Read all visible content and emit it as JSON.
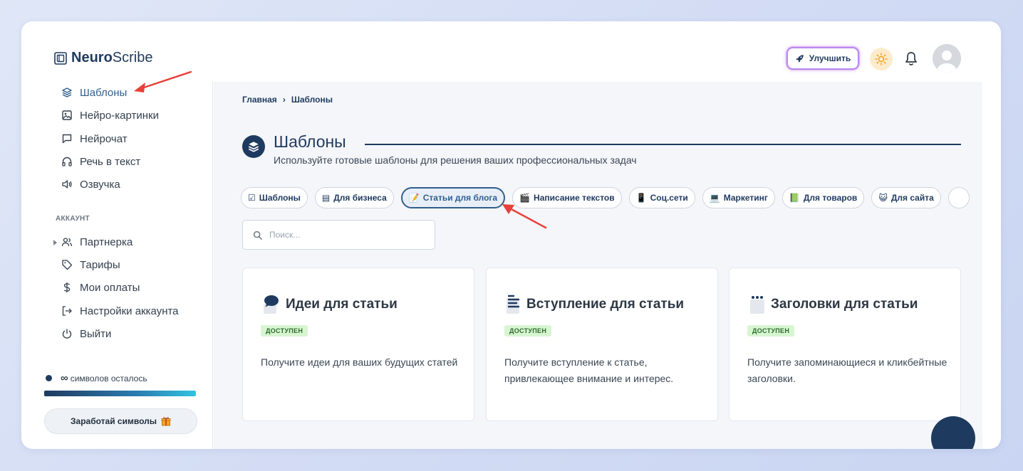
{
  "app": {
    "logo_bold": "Neuro",
    "logo_regular": "Scribe"
  },
  "header": {
    "upgrade_label": "Улучшить"
  },
  "sidebar": {
    "items": [
      {
        "label": "Шаблоны",
        "icon": "layers-icon",
        "active": true
      },
      {
        "label": "Нейро-картинки",
        "icon": "image-icon"
      },
      {
        "label": "Нейрочат",
        "icon": "chat-icon"
      },
      {
        "label": "Речь в текст",
        "icon": "headphones-icon"
      },
      {
        "label": "Озвучка",
        "icon": "speaker-icon"
      }
    ],
    "account_label": "АККАУНТ",
    "account_items": [
      {
        "label": "Партнерка",
        "icon": "users-icon"
      },
      {
        "label": "Тарифы",
        "icon": "tag-icon"
      },
      {
        "label": "Мои оплаты",
        "icon": "dollar-icon"
      },
      {
        "label": "Настройки аккаунта",
        "icon": "login-icon"
      },
      {
        "label": "Выйти",
        "icon": "power-icon"
      }
    ],
    "symbols_value": "∞",
    "symbols_label": "символов осталось",
    "symbols_progress": 1.0,
    "earn_label": "Заработай символы"
  },
  "main": {
    "breadcrumb": {
      "home": "Главная",
      "separator": "›",
      "current": "Шаблоны"
    },
    "title": "Шаблоны",
    "subtitle": "Используйте готовые шаблоны для решения ваших профессиональных задач",
    "chips": [
      {
        "emoji": "☑",
        "label": "Шаблоны"
      },
      {
        "emoji": "▤",
        "label": "Для бизнеса"
      },
      {
        "emoji": "📝",
        "label": "Статьи для блога",
        "active": true
      },
      {
        "emoji": "🎬",
        "label": "Написание текстов"
      },
      {
        "emoji": "📱",
        "label": "Соц.сети"
      },
      {
        "emoji": "💻",
        "label": "Маркетинг"
      },
      {
        "emoji": "📗",
        "label": "Для товаров"
      },
      {
        "emoji": "😺",
        "label": "Для сайта"
      }
    ],
    "search_placeholder": "Поиск...",
    "cards": [
      {
        "title": "Идеи для статьи",
        "icon": "speech-bubble-icon",
        "badge": "ДОСТУПЕН",
        "description": "Получите идеи для ваших будущих статей"
      },
      {
        "title": "Вступление для статьи",
        "icon": "text-lines-icon",
        "badge": "ДОСТУПЕН",
        "description": "Получите вступление к статье, привлекающее внимание и интерес."
      },
      {
        "title": "Заголовки для статьи",
        "icon": "dots-note-icon",
        "badge": "ДОСТУПЕН",
        "description": "Получите запоминающиеся и кликбейтные заголовки."
      }
    ]
  },
  "colors": {
    "brand_navy": "#1f3a5f",
    "active_blue": "#2f5f8f",
    "badge_green": "#d8f5d2",
    "annotation_red": "#e8403a"
  }
}
